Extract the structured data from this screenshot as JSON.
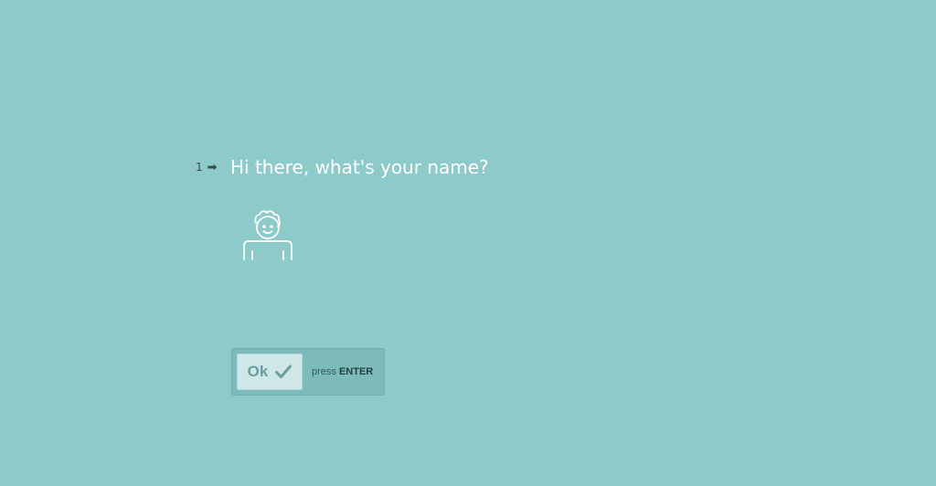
{
  "question": {
    "number": "1",
    "arrow": "➡",
    "text": "Hi there, what's your name?"
  },
  "avatar": {
    "icon": "person-avatar-icon"
  },
  "submit": {
    "label": "Ok",
    "icon": "checkmark-icon",
    "hint_prefix": "press",
    "hint_key": "ENTER"
  },
  "colors": {
    "background": "#8ccbca",
    "text": "#ffffff",
    "button_fill": "#cfe8e7"
  }
}
